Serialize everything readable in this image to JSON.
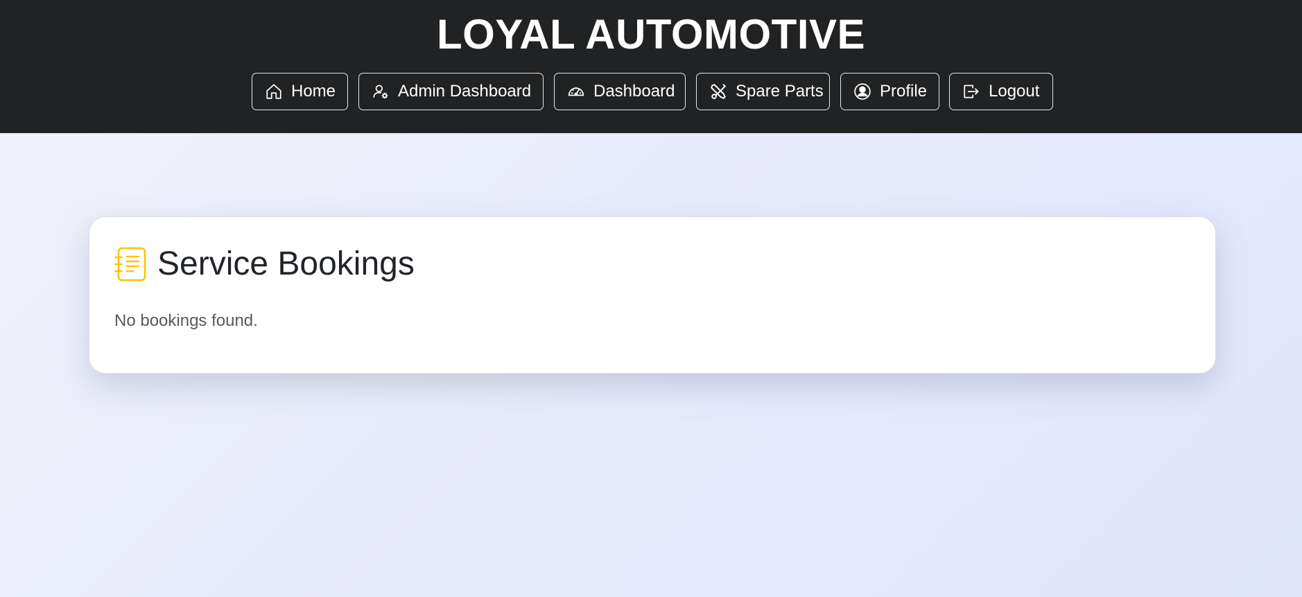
{
  "header": {
    "brand": "LOYAL AUTOMOTIVE",
    "background_color": "#212223",
    "nav": [
      {
        "label": "Home",
        "icon": "home-icon"
      },
      {
        "label": "Admin Dashboard",
        "icon": "user-gear-icon"
      },
      {
        "label": "Dashboard",
        "icon": "speedometer-icon"
      },
      {
        "label": "Spare Parts",
        "icon": "tools-icon"
      },
      {
        "label": "Profile",
        "icon": "person-circle-icon"
      },
      {
        "label": "Logout",
        "icon": "logout-icon"
      }
    ]
  },
  "main": {
    "card": {
      "icon": "journal-text-icon",
      "icon_color": "#ffc107",
      "title": "Service Bookings",
      "empty_message": "No bookings found."
    }
  }
}
